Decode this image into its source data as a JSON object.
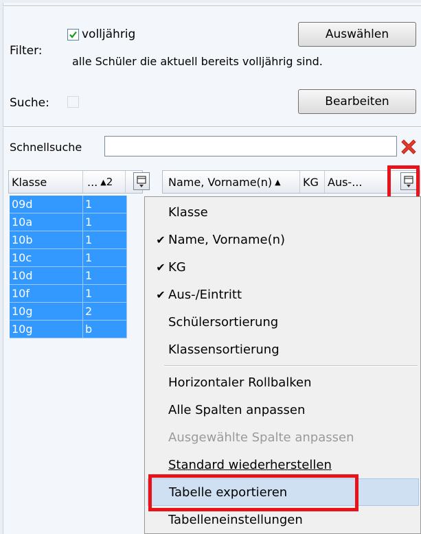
{
  "filter": {
    "label": "Filter:",
    "checkbox_label": "volljährig",
    "checked": true,
    "description": "alle Schüler die aktuell bereits volljährig sind.",
    "select_button": "Auswählen"
  },
  "search": {
    "label": "Suche:",
    "checked": false,
    "edit_button": "Bearbeiten"
  },
  "quicksearch": {
    "label": "Schnellsuche",
    "value": ""
  },
  "left_grid": {
    "headers": [
      "Klasse",
      "...",
      "2"
    ],
    "rows": [
      {
        "klasse": "09d",
        "val": "1"
      },
      {
        "klasse": "10a",
        "val": "1"
      },
      {
        "klasse": "10b",
        "val": "1"
      },
      {
        "klasse": "10c",
        "val": "1"
      },
      {
        "klasse": "10d",
        "val": "1"
      },
      {
        "klasse": "10f",
        "val": "1"
      },
      {
        "klasse": "10g",
        "val": "2"
      },
      {
        "klasse": "10g",
        "val": "b"
      }
    ]
  },
  "right_grid": {
    "headers": [
      "Name, Vorname(n)",
      "KG",
      "Aus-..."
    ]
  },
  "context_menu": {
    "items": [
      {
        "label": "Klasse",
        "checked": false,
        "disabled": false
      },
      {
        "label": "Name, Vorname(n)",
        "checked": true,
        "disabled": false
      },
      {
        "label": "KG",
        "checked": true,
        "disabled": false
      },
      {
        "label": "Aus-/Eintritt",
        "checked": true,
        "disabled": false
      },
      {
        "label": "Schülersortierung",
        "checked": false,
        "disabled": false
      },
      {
        "label": "Klassensortierung",
        "checked": false,
        "disabled": false
      },
      {
        "label": "Horizontaler Rollbalken",
        "checked": false,
        "disabled": false
      },
      {
        "label": "Alle Spalten anpassen",
        "checked": false,
        "disabled": false
      },
      {
        "label": "Ausgewählte Spalte anpassen",
        "checked": false,
        "disabled": true
      },
      {
        "label": "Standard wiederherstellen",
        "checked": false,
        "disabled": false
      },
      {
        "label": "Tabelle exportieren",
        "checked": false,
        "disabled": false
      },
      {
        "label": "Tabelleneinstellungen",
        "checked": false,
        "disabled": false
      }
    ],
    "check_glyph": "✔"
  },
  "colors": {
    "selection": "#3399ff",
    "highlight_box": "#e8121b",
    "delete_icon": "#e23b2e"
  }
}
